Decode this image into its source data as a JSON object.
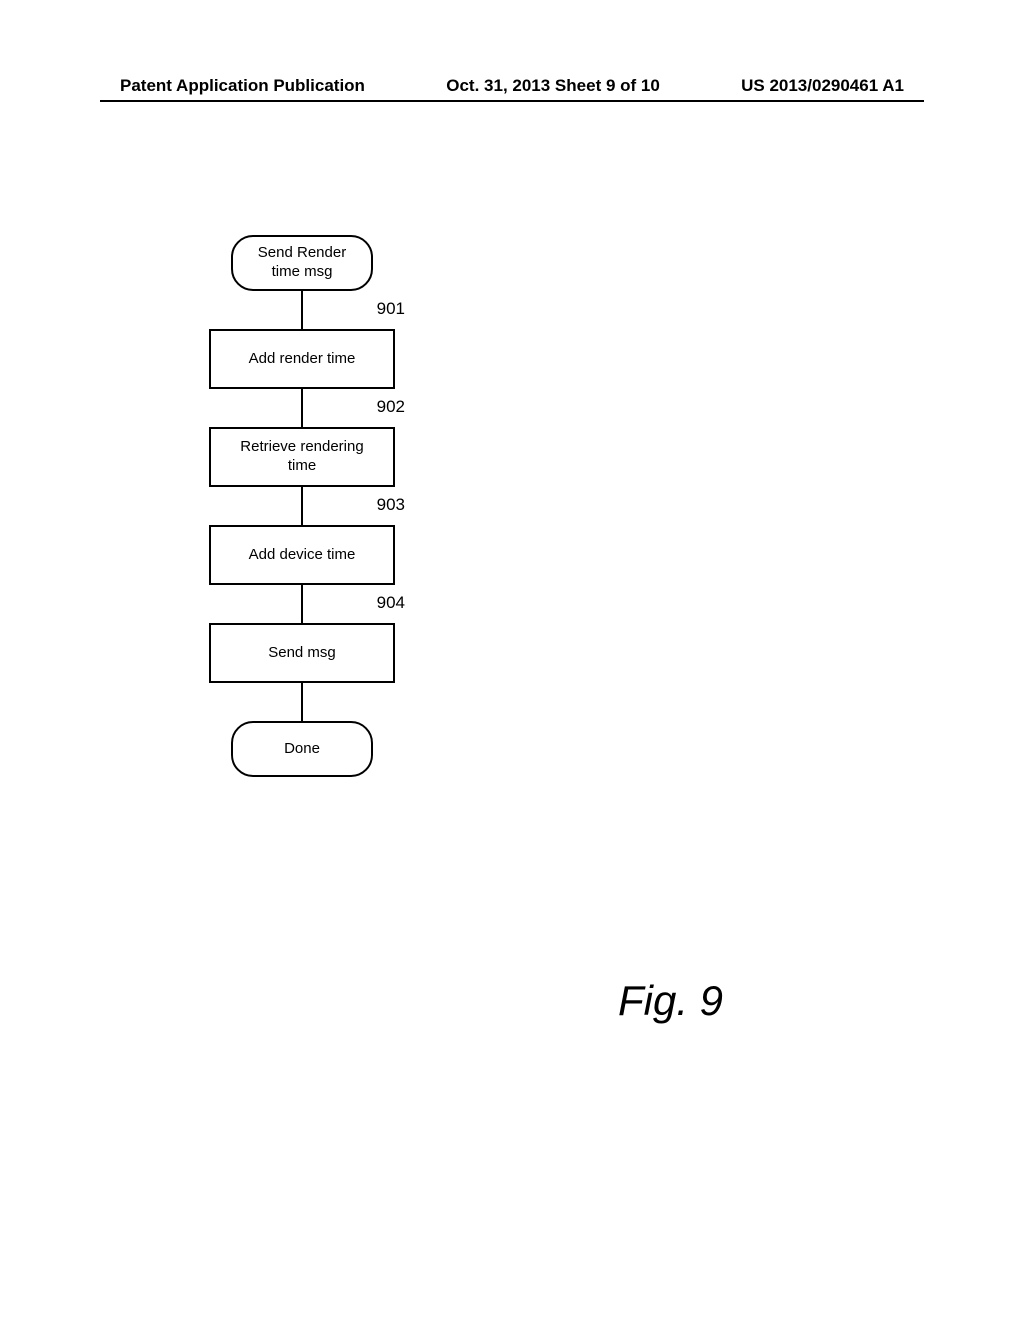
{
  "header": {
    "left": "Patent Application Publication",
    "center": "Oct. 31, 2013  Sheet 9 of 10",
    "right": "US 2013/0290461 A1"
  },
  "flowchart": {
    "start": "Send Render\ntime msg",
    "steps": [
      {
        "ref": "901",
        "label": "Add render time"
      },
      {
        "ref": "902",
        "label": "Retrieve rendering\ntime"
      },
      {
        "ref": "903",
        "label": "Add device time"
      },
      {
        "ref": "904",
        "label": "Send msg"
      }
    ],
    "end": "Done"
  },
  "figure_label": "Fig. 9"
}
